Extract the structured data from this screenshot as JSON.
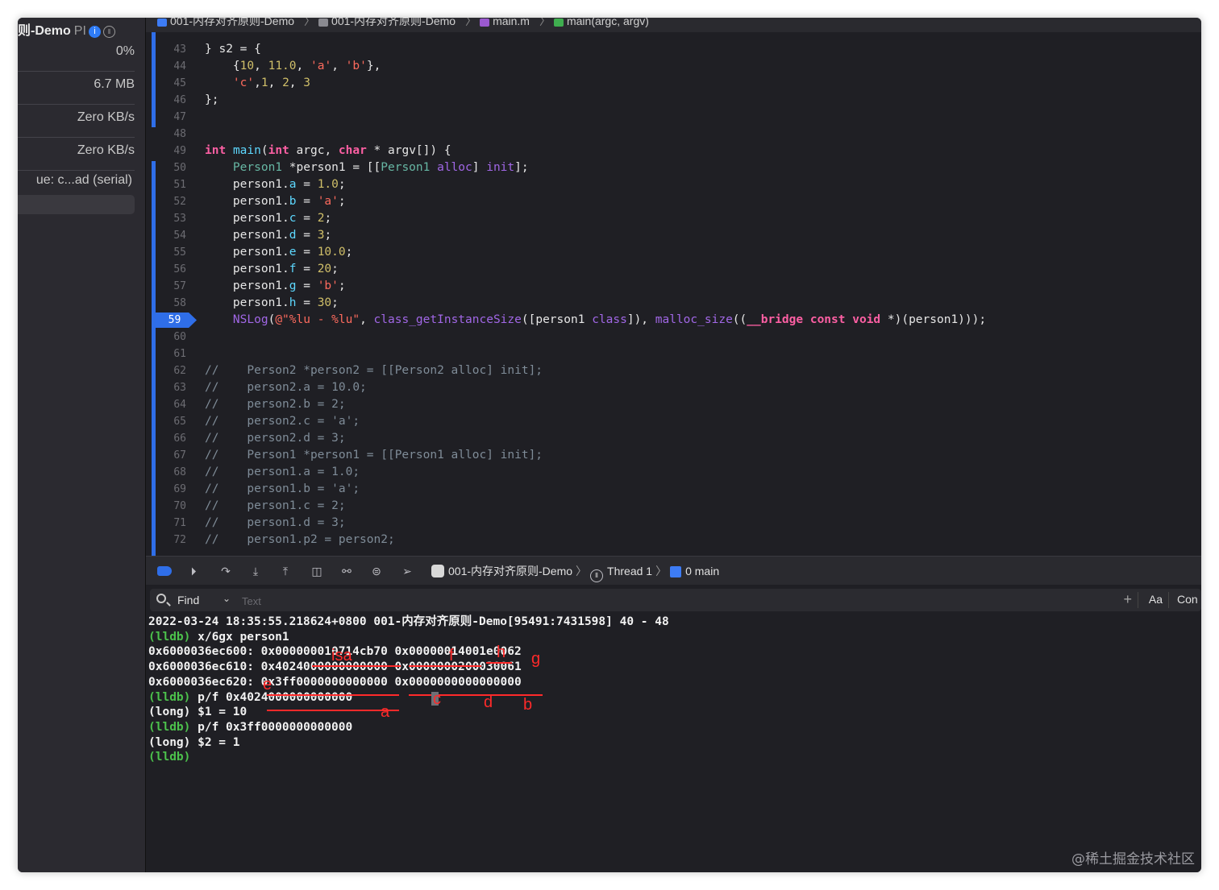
{
  "sidebar": {
    "title_name": "则-Demo",
    "title_suffix": "PI",
    "info_glyph": "i",
    "thread_glyph": "⦀",
    "cpu": "0%",
    "memory": "6.7 MB",
    "disk": "Zero KB/s",
    "network": "Zero KB/s",
    "queue": "ue: c...ad (serial)"
  },
  "breadcrumb": {
    "items": [
      "001-内存对齐原则-Demo",
      "001-内存对齐原则-Demo",
      "main.m",
      "main(argc, argv)"
    ],
    "separator": "〉"
  },
  "editor": {
    "breakpoint_line": "59",
    "lines": [
      {
        "n": "43",
        "text": "} s2 = {"
      },
      {
        "n": "44",
        "text": "    {10, 11.0, 'a', 'b'},"
      },
      {
        "n": "45",
        "text": "    'c',1, 2, 3"
      },
      {
        "n": "46",
        "text": "};"
      },
      {
        "n": "47",
        "text": ""
      },
      {
        "n": "48",
        "text": ""
      },
      {
        "n": "49",
        "text": "int main(int argc, char * argv[]) {"
      },
      {
        "n": "50",
        "text": "    Person1 *person1 = [[Person1 alloc] init];"
      },
      {
        "n": "51",
        "text": "    person1.a = 1.0;"
      },
      {
        "n": "52",
        "text": "    person1.b = 'a';"
      },
      {
        "n": "53",
        "text": "    person1.c = 2;"
      },
      {
        "n": "54",
        "text": "    person1.d = 3;"
      },
      {
        "n": "55",
        "text": "    person1.e = 10.0;"
      },
      {
        "n": "56",
        "text": "    person1.f = 20;"
      },
      {
        "n": "57",
        "text": "    person1.g = 'b';"
      },
      {
        "n": "58",
        "text": "    person1.h = 30;"
      },
      {
        "n": "59",
        "text": "    NSLog(@\"%lu - %lu\", class_getInstanceSize([person1 class]), malloc_size((__bridge const void *)(person1)));"
      },
      {
        "n": "60",
        "text": ""
      },
      {
        "n": "61",
        "text": ""
      },
      {
        "n": "62",
        "text": "//    Person2 *person2 = [[Person2 alloc] init];"
      },
      {
        "n": "63",
        "text": "//    person2.a = 10.0;"
      },
      {
        "n": "64",
        "text": "//    person2.b = 2;"
      },
      {
        "n": "65",
        "text": "//    person2.c = 'a';"
      },
      {
        "n": "66",
        "text": "//    person2.d = 3;"
      },
      {
        "n": "67",
        "text": "//    Person1 *person1 = [[Person1 alloc] init];"
      },
      {
        "n": "68",
        "text": "//    person1.a = 1.0;"
      },
      {
        "n": "69",
        "text": "//    person1.b = 'a';"
      },
      {
        "n": "70",
        "text": "//    person1.c = 2;"
      },
      {
        "n": "71",
        "text": "//    person1.d = 3;"
      },
      {
        "n": "72",
        "text": "//    person1.p2 = person2;"
      }
    ]
  },
  "debugbar": {
    "app": "001-内存对齐原则-Demo",
    "thread": "Thread 1",
    "frame": "0 main",
    "separator": "〉"
  },
  "console": {
    "find_label": "Find",
    "find_placeholder": "Text",
    "plus": "+",
    "aa": "Aa",
    "con": "Con",
    "output": [
      {
        "prompt": "",
        "text": "2022-03-24 18:35:55.218624+0800 001-内存对齐原则-Demo[95491:7431598] 40 - 48"
      },
      {
        "prompt": "(lldb)",
        "text": " x/6gx person1"
      },
      {
        "prompt": "",
        "text": "0x6000036ec600: 0x000000010714cb70 0x00000014001e0062"
      },
      {
        "prompt": "",
        "text": "0x6000036ec610: 0x4024000000000000 0x0000000200030061"
      },
      {
        "prompt": "",
        "text": "0x6000036ec620: 0x3ff0000000000000 0x0000000000000000"
      },
      {
        "prompt": "(lldb)",
        "text": " p/f 0x4024000000000000"
      },
      {
        "prompt": "",
        "text": "(long) $1 = 10"
      },
      {
        "prompt": "(lldb)",
        "text": " p/f 0x3ff0000000000000"
      },
      {
        "prompt": "",
        "text": "(long) $2 = 1"
      },
      {
        "prompt": "(lldb)",
        "text": ""
      }
    ],
    "annotations": {
      "isa": "isa",
      "f": "f",
      "h": "h",
      "g": "g",
      "e": "e",
      "a": "a",
      "c": "c",
      "d": "d",
      "b": "b"
    }
  },
  "watermark": "@稀土掘金技术社区",
  "colors": {
    "accent": "#2f6ee8",
    "keyword": "#fc5fa3",
    "number": "#d0bf69",
    "string": "#fc6a5d",
    "type": "#5dd8ff",
    "function": "#a167e6",
    "lldb_prompt": "#4cc24c",
    "annotation": "#ff2a2a"
  }
}
